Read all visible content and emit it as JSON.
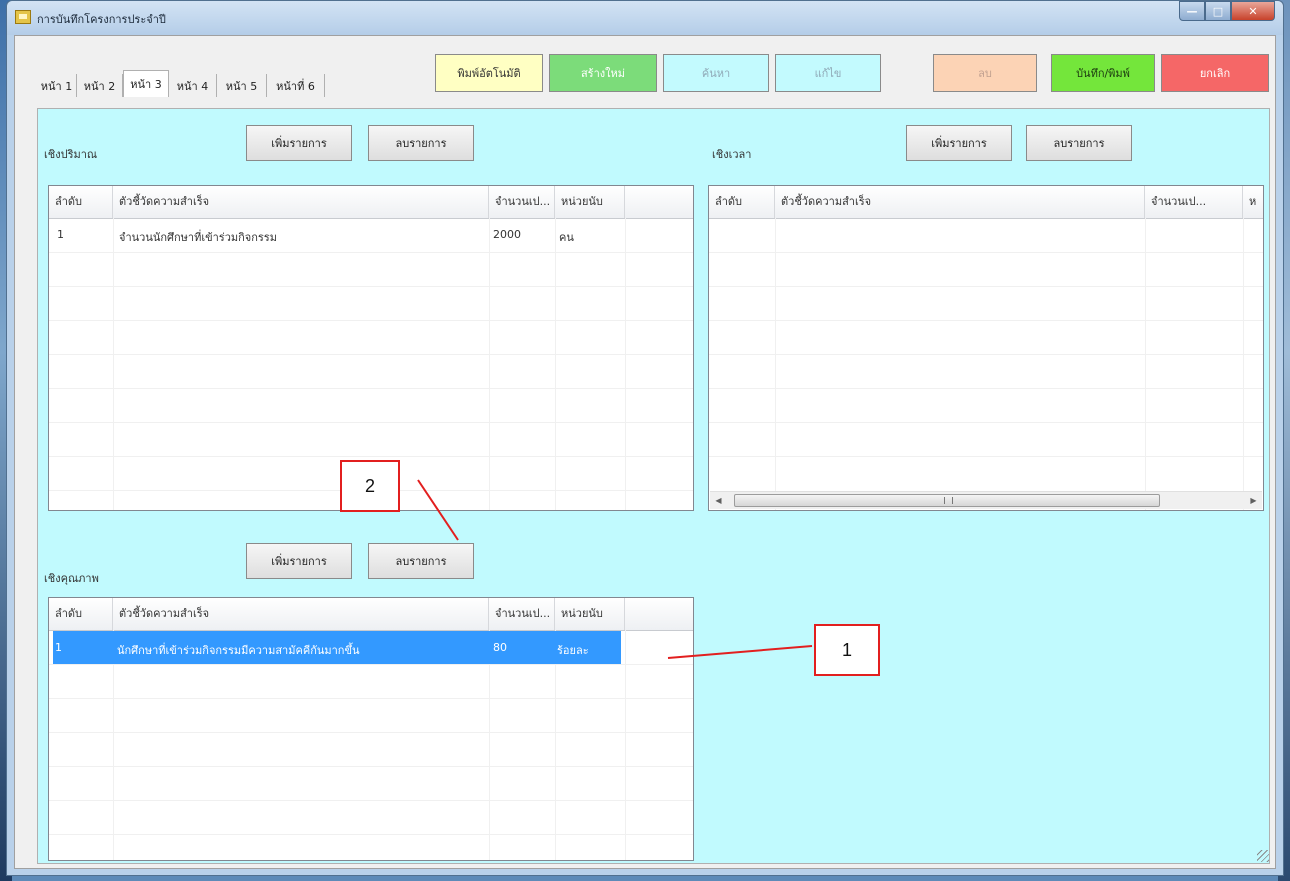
{
  "window": {
    "title": "การบันทึกโครงการประจำปี",
    "controls": {
      "minimize": "—",
      "maximize": "□",
      "close": "✕"
    }
  },
  "tabs": [
    {
      "label": "หน้า 1",
      "active": false
    },
    {
      "label": "หน้า 2",
      "active": false
    },
    {
      "label": "หน้า 3",
      "active": true
    },
    {
      "label": "หน้า 4",
      "active": false
    },
    {
      "label": "หน้า 5",
      "active": false
    },
    {
      "label": "หน้าที่ 6",
      "active": false
    }
  ],
  "toolbar": {
    "print_approved": "พิมพ์อัตโนมัติ",
    "new": "สร้างใหม่",
    "search": "ค้นหา",
    "edit": "แก้ไข",
    "delete": "ลบ",
    "save_print": "บันทึก/พิมพ์",
    "cancel": "ยกเลิก"
  },
  "colors": {
    "panel_bg": "#c1fafe",
    "selected_row": "#3399ff",
    "callout_red": "#e21f1f"
  },
  "quantity": {
    "label": "เชิงปริมาณ",
    "add_label": "เพิ่มรายการ",
    "remove_label": "ลบรายการ",
    "columns": [
      "ลำดับ",
      "ตัวชี้วัดความสำเร็จ",
      "จำนวนเป...",
      "หน่วยนับ"
    ],
    "rows": [
      {
        "no": "1",
        "indicator": "จำนวนนักศึกษาที่เข้าร่วมกิจกรรม",
        "amount": "2000",
        "unit": "คน"
      }
    ]
  },
  "time": {
    "label": "เชิงเวลา",
    "add_label": "เพิ่มรายการ",
    "remove_label": "ลบรายการ",
    "columns": [
      "ลำดับ",
      "ตัวชี้วัดความสำเร็จ",
      "จำนวนเป...",
      "ห"
    ],
    "scroll_grip": "|||"
  },
  "quality": {
    "label": "เชิงคุณภาพ",
    "add_label": "เพิ่มรายการ",
    "remove_label": "ลบรายการ",
    "columns": [
      "ลำดับ",
      "ตัวชี้วัดความสำเร็จ",
      "จำนวนเป...",
      "หน่วยนับ"
    ],
    "rows": [
      {
        "no": "1",
        "indicator": "นักศึกษาที่เข้าร่วมกิจกรรมมีความสามัคคีกันมากขึ้น",
        "amount": "80",
        "unit": "ร้อยละ",
        "selected": true
      }
    ]
  },
  "annotations": {
    "callout1": "1",
    "callout2": "2"
  }
}
